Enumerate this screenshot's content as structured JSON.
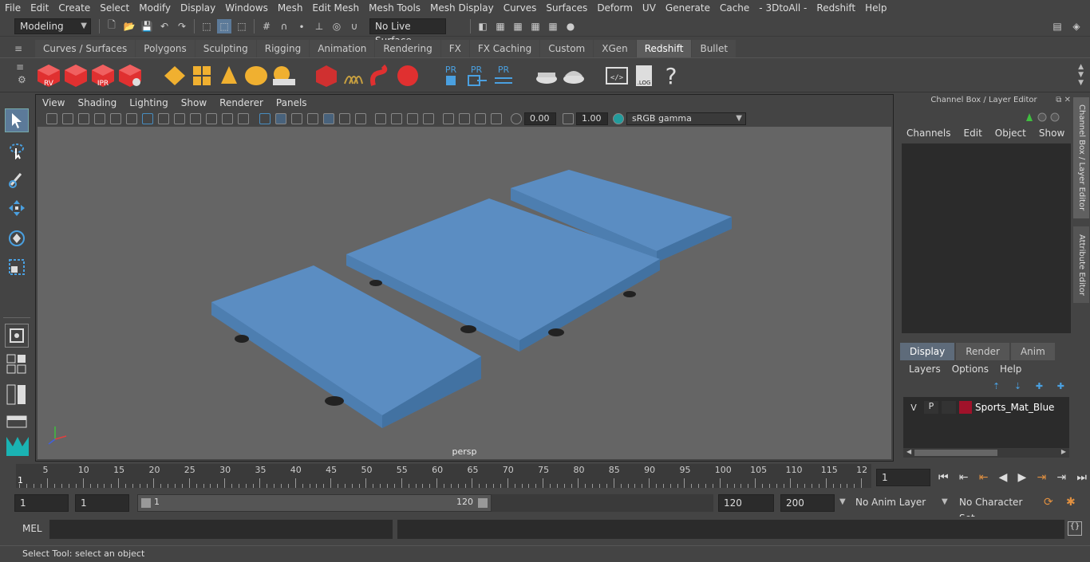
{
  "menu": [
    "File",
    "Edit",
    "Create",
    "Select",
    "Modify",
    "Display",
    "Windows",
    "Mesh",
    "Edit Mesh",
    "Mesh Tools",
    "Mesh Display",
    "Curves",
    "Surfaces",
    "Deform",
    "UV",
    "Generate",
    "Cache",
    "- 3DtoAll -",
    "Redshift",
    "Help"
  ],
  "status": {
    "mode": "Modeling",
    "live_surface": "No Live Surface"
  },
  "shelf_tabs": [
    "Curves / Surfaces",
    "Polygons",
    "Sculpting",
    "Rigging",
    "Animation",
    "Rendering",
    "FX",
    "FX Caching",
    "Custom",
    "XGen",
    "Redshift",
    "Bullet"
  ],
  "shelf_active": "Redshift",
  "shelf_icons": {
    "rv": "RV",
    "ipr": "IPR",
    "pr": "PR",
    "log": ".LOG",
    "help": "?"
  },
  "viewport": {
    "menu": [
      "View",
      "Shading",
      "Lighting",
      "Show",
      "Renderer",
      "Panels"
    ],
    "exposure": "0.00",
    "gamma": "1.00",
    "colorspace": "sRGB gamma",
    "camera": "persp"
  },
  "channel_box": {
    "title": "Channel Box / Layer Editor",
    "menu": [
      "Channels",
      "Edit",
      "Object",
      "Show"
    ],
    "layer_tabs": [
      "Display",
      "Render",
      "Anim"
    ],
    "layer_menu": [
      "Layers",
      "Options",
      "Help"
    ],
    "layer": {
      "v": "V",
      "p": "P",
      "name": "Sports_Mat_Blue",
      "color": "#a0122a"
    }
  },
  "side_tabs": [
    "Channel Box / Layer Editor",
    "Attribute Editor"
  ],
  "timeline": {
    "ticks": [
      "5",
      "10",
      "15",
      "20",
      "25",
      "30",
      "35",
      "40",
      "45",
      "50",
      "55",
      "60",
      "65",
      "70",
      "75",
      "80",
      "85",
      "90",
      "95",
      "100",
      "105",
      "110",
      "115",
      "12"
    ],
    "start_label": "1",
    "current": "1"
  },
  "range": {
    "start": "1",
    "start2": "1",
    "slider_start": "1",
    "slider_end": "120",
    "end": "120",
    "end2": "200",
    "anim_layer": "No Anim Layer",
    "char_set": "No Character Set"
  },
  "command": {
    "lang": "MEL"
  },
  "help": "Select Tool: select an object"
}
